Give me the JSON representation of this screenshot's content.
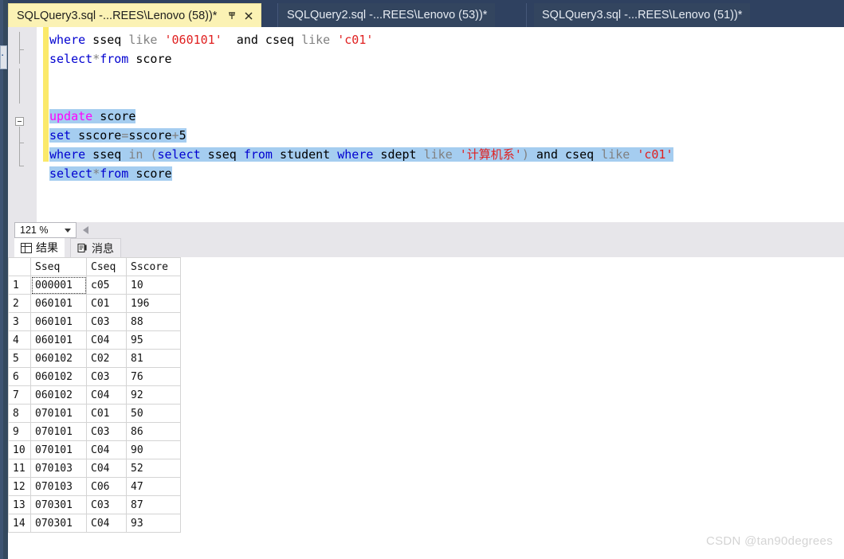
{
  "window": {
    "tabs": [
      {
        "label": "SQLQuery3.sql -...REES\\Lenovo (58))*",
        "active": true,
        "pin_icon": "pin-icon",
        "close_icon": "close-icon"
      },
      {
        "label": "SQLQuery2.sql -...REES\\Lenovo (53))*",
        "active": false
      },
      {
        "label": "SQLQuery3.sql -...REES\\Lenovo (51))*",
        "active": false
      }
    ]
  },
  "editor": {
    "lines": [
      {
        "n": 1,
        "tokens": [
          {
            "t": "where",
            "c": "kw"
          },
          {
            "t": " sseq ",
            "c": "plain"
          },
          {
            "t": "like",
            "c": "kw-gray"
          },
          {
            "t": " ",
            "c": "plain"
          },
          {
            "t": "'060101'",
            "c": "str"
          },
          {
            "t": "  and cseq ",
            "c": "plain"
          },
          {
            "t": "like",
            "c": "kw-gray"
          },
          {
            "t": " ",
            "c": "plain"
          },
          {
            "t": "'c01'",
            "c": "str"
          }
        ]
      },
      {
        "n": 2,
        "tokens": [
          {
            "t": "select",
            "c": "kw"
          },
          {
            "t": "*",
            "c": "kw-gray"
          },
          {
            "t": "from",
            "c": "kw"
          },
          {
            "t": " score",
            "c": "plain"
          }
        ]
      },
      {
        "n": 3,
        "tokens": []
      },
      {
        "n": 4,
        "tokens": []
      },
      {
        "n": 5,
        "selected": true,
        "tokens": [
          {
            "t": "update",
            "c": "kw-pink"
          },
          {
            "t": " score",
            "c": "plain"
          }
        ]
      },
      {
        "n": 6,
        "selected": true,
        "tokens": [
          {
            "t": "set",
            "c": "kw"
          },
          {
            "t": " sscore",
            "c": "plain"
          },
          {
            "t": "=",
            "c": "kw-gray"
          },
          {
            "t": "sscore",
            "c": "plain"
          },
          {
            "t": "+",
            "c": "kw-gray"
          },
          {
            "t": "5",
            "c": "plain"
          }
        ]
      },
      {
        "n": 7,
        "selected": true,
        "tokens": [
          {
            "t": "where",
            "c": "kw"
          },
          {
            "t": " sseq ",
            "c": "plain"
          },
          {
            "t": "in",
            "c": "kw-gray"
          },
          {
            "t": " ",
            "c": "plain"
          },
          {
            "t": "(",
            "c": "paren"
          },
          {
            "t": "select",
            "c": "kw"
          },
          {
            "t": " sseq ",
            "c": "plain"
          },
          {
            "t": "from",
            "c": "kw"
          },
          {
            "t": " student ",
            "c": "plain"
          },
          {
            "t": "where",
            "c": "kw"
          },
          {
            "t": " sdept ",
            "c": "plain"
          },
          {
            "t": "like",
            "c": "kw-gray"
          },
          {
            "t": " ",
            "c": "plain"
          },
          {
            "t": "'计算机系'",
            "c": "str"
          },
          {
            "t": ")",
            "c": "paren"
          },
          {
            "t": " and cseq ",
            "c": "plain"
          },
          {
            "t": "like",
            "c": "kw-gray"
          },
          {
            "t": " ",
            "c": "plain"
          },
          {
            "t": "'c01'",
            "c": "str"
          }
        ]
      },
      {
        "n": 8,
        "selected": true,
        "tokens": [
          {
            "t": "select",
            "c": "kw"
          },
          {
            "t": "*",
            "c": "kw-gray"
          },
          {
            "t": "from",
            "c": "kw"
          },
          {
            "t": " score",
            "c": "plain"
          }
        ]
      }
    ],
    "fold_marker": "collapse-minus-icon"
  },
  "statusbar": {
    "zoom_value": "121 %",
    "zoom_caret_icon": "chevron-down-icon",
    "scroll_left_icon": "scroll-left-arrow-icon"
  },
  "result_tabs": [
    {
      "label": "结果",
      "icon": "grid-icon",
      "active": true
    },
    {
      "label": "消息",
      "icon": "message-icon",
      "active": false
    }
  ],
  "results_grid": {
    "columns": [
      "Sseq",
      "Cseq",
      "Sscore"
    ],
    "rows": [
      {
        "n": "1",
        "Sseq": "000001",
        "Cseq": "c05",
        "Sscore": "10",
        "selected": true
      },
      {
        "n": "2",
        "Sseq": "060101",
        "Cseq": "C01",
        "Sscore": "196"
      },
      {
        "n": "3",
        "Sseq": "060101",
        "Cseq": "C03",
        "Sscore": "88"
      },
      {
        "n": "4",
        "Sseq": "060101",
        "Cseq": "C04",
        "Sscore": "95"
      },
      {
        "n": "5",
        "Sseq": "060102",
        "Cseq": "C02",
        "Sscore": "81"
      },
      {
        "n": "6",
        "Sseq": "060102",
        "Cseq": "C03",
        "Sscore": "76"
      },
      {
        "n": "7",
        "Sseq": "060102",
        "Cseq": "C04",
        "Sscore": "92"
      },
      {
        "n": "8",
        "Sseq": "070101",
        "Cseq": "C01",
        "Sscore": "50"
      },
      {
        "n": "9",
        "Sseq": "070101",
        "Cseq": "C03",
        "Sscore": "86"
      },
      {
        "n": "10",
        "Sseq": "070101",
        "Cseq": "C04",
        "Sscore": "90"
      },
      {
        "n": "11",
        "Sseq": "070103",
        "Cseq": "C04",
        "Sscore": "52"
      },
      {
        "n": "12",
        "Sseq": "070103",
        "Cseq": "C06",
        "Sscore": "47"
      },
      {
        "n": "13",
        "Sseq": "070301",
        "Cseq": "C03",
        "Sscore": "87"
      },
      {
        "n": "14",
        "Sseq": "070301",
        "Cseq": "C04",
        "Sscore": "93"
      }
    ]
  },
  "watermark": {
    "text": "CSDN @tan90degrees"
  },
  "colors": {
    "chrome": "#2f4160",
    "active_tab": "#fbf2b4",
    "selection": "#a5cdf0",
    "change_bar": "#fbe96a",
    "keyword": "#0000d0",
    "keyword_pink": "#ff00ff",
    "string": "#e02020",
    "gray_token": "#808080"
  }
}
